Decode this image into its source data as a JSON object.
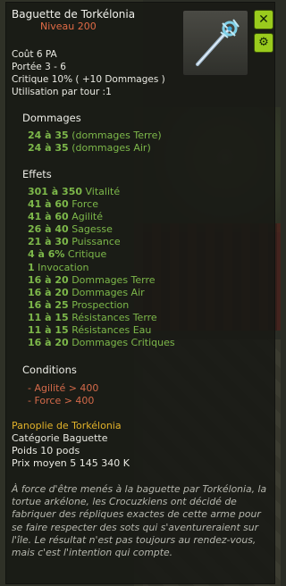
{
  "item": {
    "name": "Baguette de Torkélonia",
    "level": "Niveau  200"
  },
  "stats": [
    {
      "label": "Coût",
      "value": "6 PA"
    },
    {
      "label": "Portée",
      "value": "3 - 6"
    },
    {
      "label": "Critique",
      "value": "10% ( +10 Dommages )"
    },
    {
      "label": "Utilisation par tour :",
      "value": "1"
    }
  ],
  "damages": {
    "title": "Dommages",
    "items": [
      {
        "range": "24 à 35",
        "label": "(dommages Terre)"
      },
      {
        "range": "24 à 35",
        "label": "(dommages Air)"
      }
    ]
  },
  "effects": {
    "title": "Effets",
    "items": [
      {
        "range": "301 à 350",
        "label": "Vitalité"
      },
      {
        "range": "41 à 60",
        "label": "Force"
      },
      {
        "range": "41 à 60",
        "label": "Agilité"
      },
      {
        "range": "26 à 40",
        "label": "Sagesse"
      },
      {
        "range": "21 à 30",
        "label": "Puissance"
      },
      {
        "range": "4 à 6%",
        "label": "Critique"
      },
      {
        "range": "1",
        "label": "Invocation"
      },
      {
        "range": "16 à 20",
        "label": "Dommages Terre"
      },
      {
        "range": "16 à 20",
        "label": "Dommages Air"
      },
      {
        "range": "16 à 25",
        "label": "Prospection"
      },
      {
        "range": "11 à 15",
        "label": "Résistances Terre"
      },
      {
        "range": "11 à 15",
        "label": "Résistances Eau"
      },
      {
        "range": "16 à 20",
        "label": "Dommages Critiques"
      }
    ]
  },
  "conditions": {
    "title": "Conditions",
    "items": [
      "- Agilité > 400",
      "- Force > 400"
    ]
  },
  "set_name": "Panoplie de Torkélonia",
  "meta": [
    {
      "label": "Catégorie",
      "value": "Baguette"
    },
    {
      "label": "Poids",
      "value": "10 pods"
    },
    {
      "label": "Prix moyen",
      "value": "5 145 340 K"
    }
  ],
  "description": "À force d'être menés à la baguette par Torkélonia, la tortue arkélone, les Crocuzkiens ont décidé de fabriquer des répliques exactes de cette arme pour se faire respecter des sots qui s'aventureraient sur l'île. Le résultat n'est pas toujours au rendez-vous, mais c'est l'intention qui compte.",
  "icons": {
    "close": "close-icon",
    "gear": "gear-icon",
    "item": "wand-icon"
  },
  "colors": {
    "green": "#7db84a",
    "orange": "#e06b46",
    "gold": "#e2b22a",
    "button": "#9acb1d"
  }
}
